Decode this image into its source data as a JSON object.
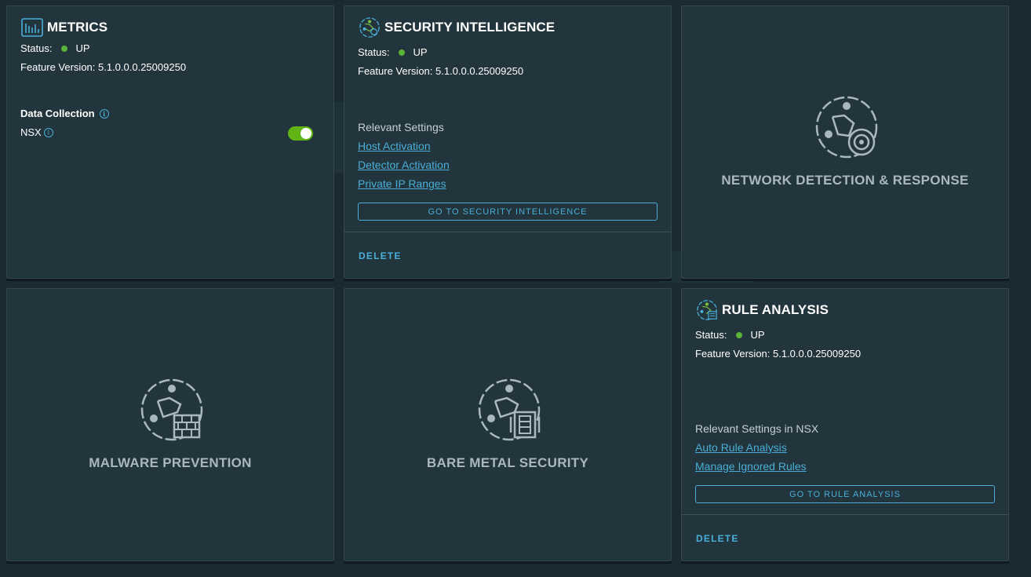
{
  "cards": {
    "metrics": {
      "title": "METRICS",
      "status_label": "Status:",
      "status_value": "UP",
      "version_text": "Feature Version: 5.1.0.0.0.25009250",
      "data_collection_label": "Data Collection",
      "nsx_label": "NSX",
      "nsx_toggle_on": true,
      "icon": "chart-icon"
    },
    "security_intelligence": {
      "title": "SECURITY INTELLIGENCE",
      "status_label": "Status:",
      "status_value": "UP",
      "version_text": "Feature Version: 5.1.0.0.0.25009250",
      "relevant_label": "Relevant Settings",
      "links": [
        "Host Activation",
        "Detector Activation",
        "Private IP Ranges"
      ],
      "go_button": "GO TO SECURITY INTELLIGENCE",
      "delete_button": "DELETE",
      "icon": "security-intelligence-icon"
    },
    "ndr": {
      "title": "NETWORK DETECTION & RESPONSE",
      "icon": "network-radar-icon"
    },
    "malware": {
      "title": "MALWARE PREVENTION",
      "icon": "firewall-brick-icon"
    },
    "bare_metal": {
      "title": "BARE METAL SECURITY",
      "icon": "server-icon"
    },
    "rule_analysis": {
      "title": "RULE ANALYSIS",
      "status_label": "Status:",
      "status_value": "UP",
      "version_text": "Feature Version: 5.1.0.0.0.25009250",
      "relevant_label": "Relevant Settings in NSX",
      "links": [
        "Auto Rule Analysis",
        "Manage Ignored Rules"
      ],
      "go_button": "GO TO RULE ANALYSIS",
      "delete_button": "DELETE",
      "icon": "rule-analysis-icon"
    }
  },
  "colors": {
    "background": "#1b2a32",
    "card": "#22343c",
    "accent": "#49afd9",
    "status_up": "#5ab438",
    "toggle_on": "#60b515",
    "muted_title": "#a9b8bf"
  }
}
